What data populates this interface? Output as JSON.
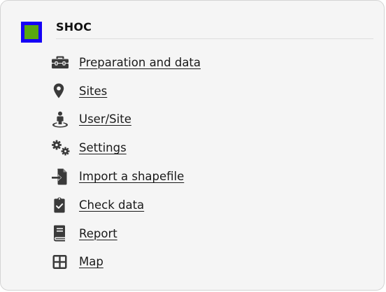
{
  "panel": {
    "title": "SHOC",
    "logo_colors": {
      "outer": "#1500f5",
      "inner": "#59a80f"
    }
  },
  "menu": {
    "items": [
      {
        "label": "Preparation and data",
        "icon": "toolbox-icon"
      },
      {
        "label": "Sites",
        "icon": "map-marker-icon"
      },
      {
        "label": "User/Site",
        "icon": "street-view-icon"
      },
      {
        "label": "Settings",
        "icon": "cogs-icon"
      },
      {
        "label": "Import a shapefile",
        "icon": "file-import-icon"
      },
      {
        "label": "Check data",
        "icon": "clipboard-check-icon"
      },
      {
        "label": "Report",
        "icon": "book-icon"
      },
      {
        "label": "Map",
        "icon": "grid-icon"
      }
    ]
  }
}
